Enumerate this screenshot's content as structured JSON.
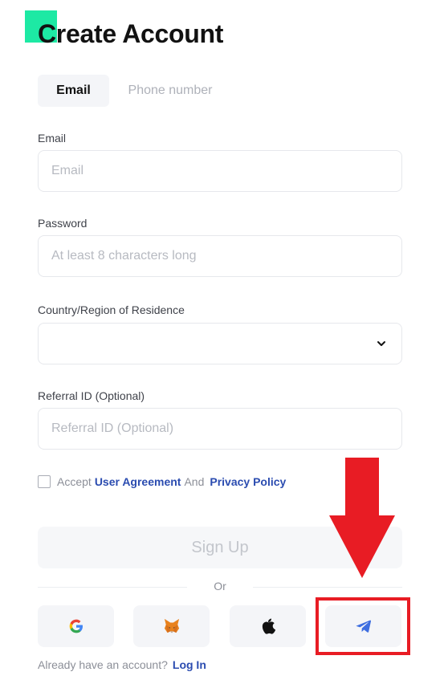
{
  "header": {
    "title": "Create Account"
  },
  "tabs": [
    {
      "label": "Email",
      "active": true
    },
    {
      "label": "Phone number",
      "active": false
    }
  ],
  "form": {
    "email": {
      "label": "Email",
      "placeholder": "Email",
      "value": ""
    },
    "password": {
      "label": "Password",
      "placeholder": "At least 8 characters long",
      "value": ""
    },
    "country": {
      "label": "Country/Region of Residence",
      "value": ""
    },
    "referral": {
      "label": "Referral ID (Optional)",
      "placeholder": "Referral ID (Optional)",
      "value": ""
    }
  },
  "terms": {
    "checked": false,
    "prefix": "Accept",
    "user_agreement": "User Agreement",
    "and": "And",
    "privacy_policy": "Privacy Policy"
  },
  "signup_button": "Sign Up",
  "divider_text": "Or",
  "social_logins": [
    "google-icon",
    "metamask-icon",
    "apple-icon",
    "telegram-icon"
  ],
  "footer": {
    "prompt": "Already have an account?",
    "login_link": "Log In"
  },
  "colors": {
    "accent": "#1de9a4",
    "link": "#2b4cb0",
    "annotation_red": "#e81c24",
    "telegram_blue": "#3e6ee0"
  }
}
